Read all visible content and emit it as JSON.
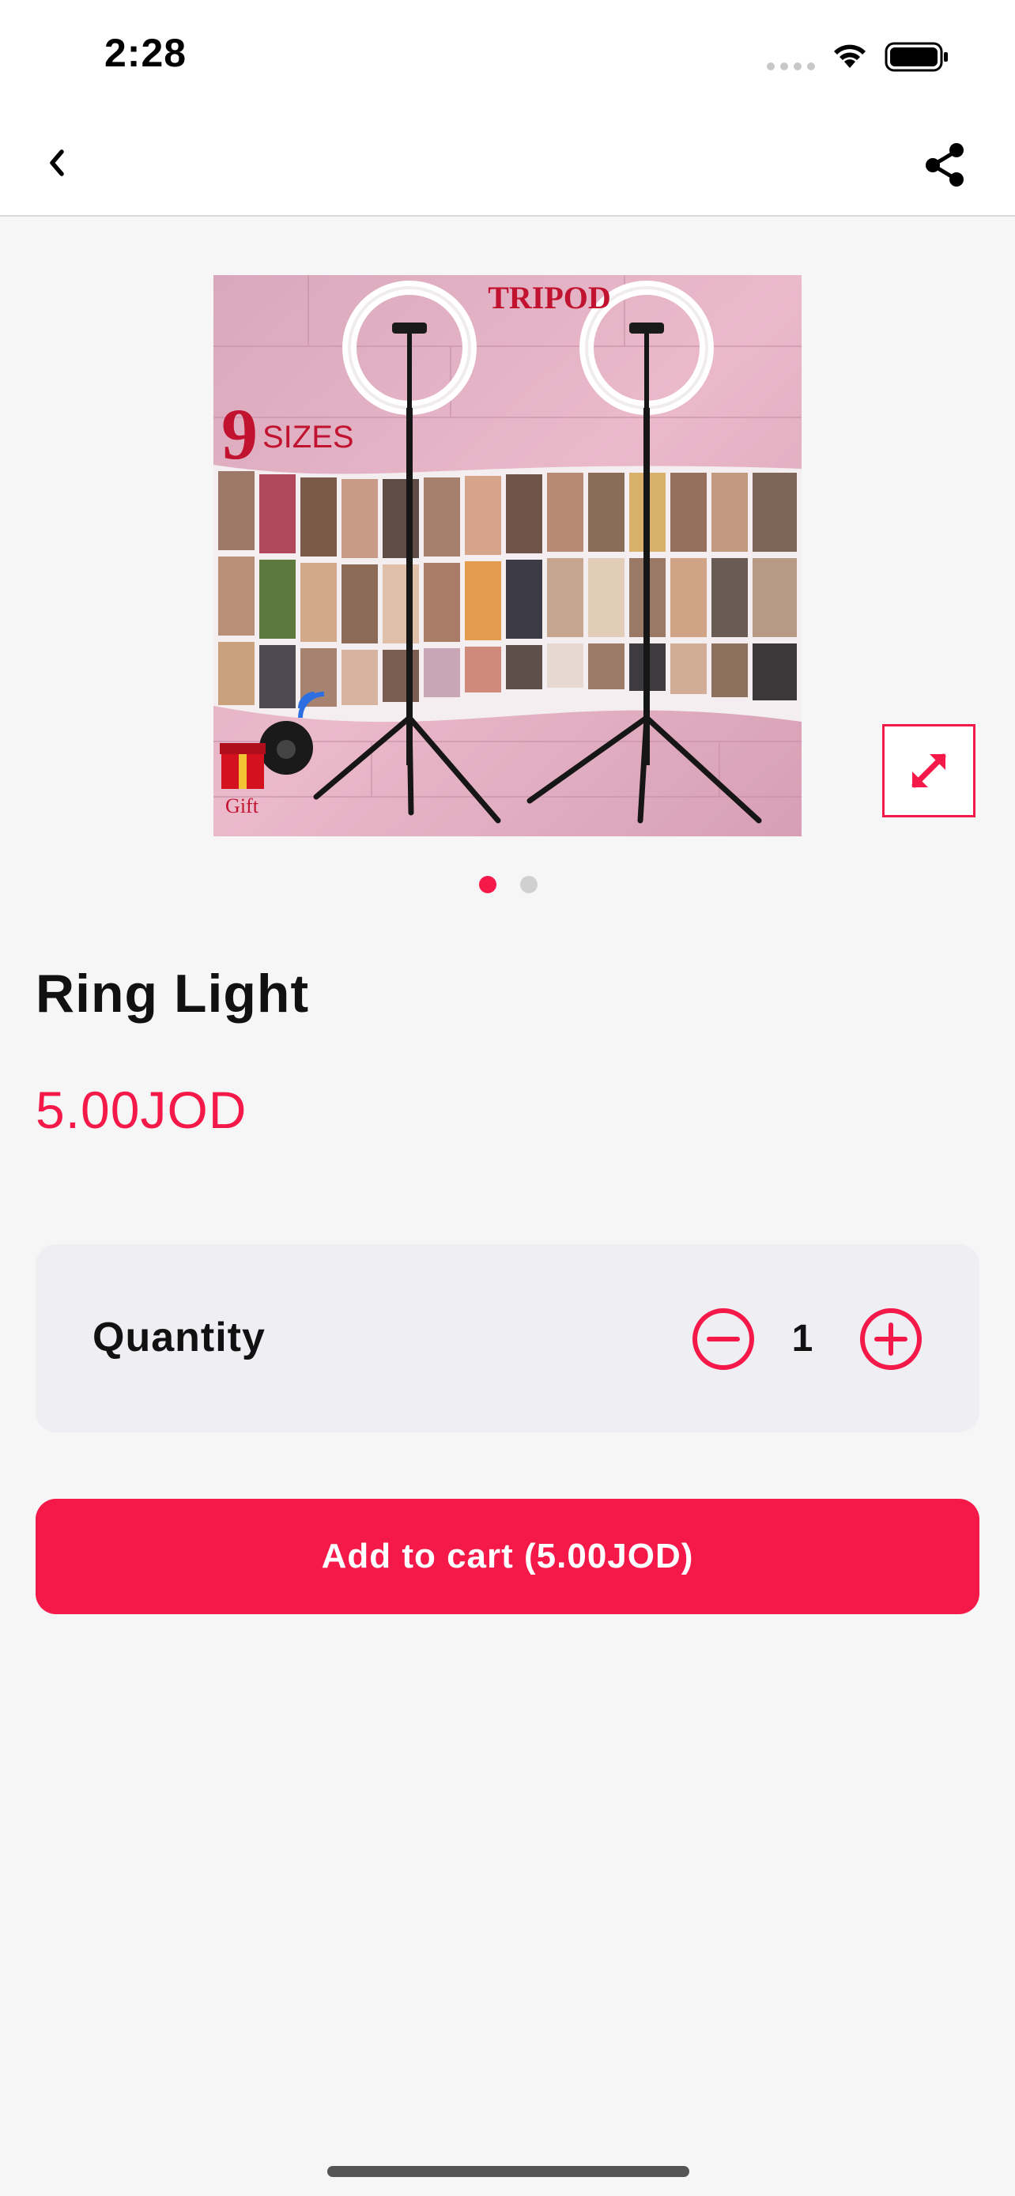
{
  "status_bar": {
    "time": "2:28"
  },
  "nav": {
    "back_icon": "chevron-left-icon",
    "share_icon": "share-icon"
  },
  "product": {
    "image_text": {
      "tripod": "TRIPOD",
      "sizes_number": "9",
      "sizes_word": "SIZES",
      "gift": "Gift"
    },
    "gallery": {
      "page_count": 2,
      "current_page": 1
    },
    "title": "Ring Light",
    "price": "5.00JOD"
  },
  "quantity": {
    "label": "Quantity",
    "value": "1"
  },
  "cart": {
    "button_label": "Add to cart (5.00JOD)"
  },
  "colors": {
    "accent": "#f5194a",
    "panel": "#efeef3",
    "background": "#f6f6f6"
  }
}
